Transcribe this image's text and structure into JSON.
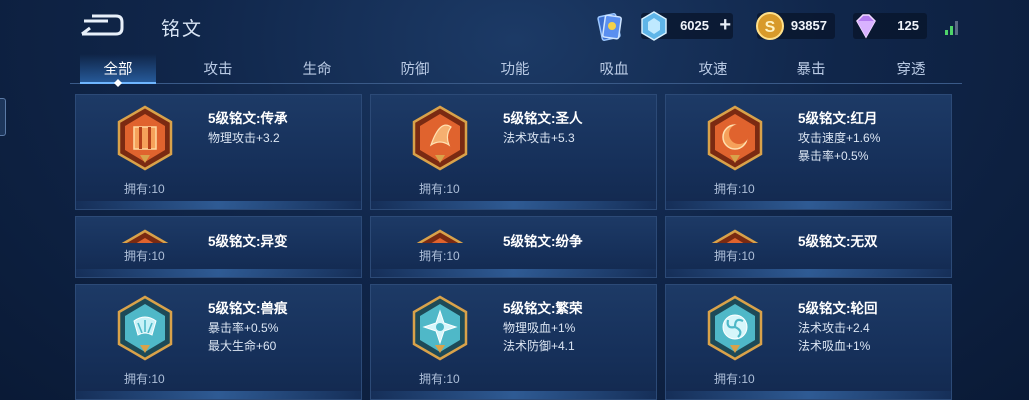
{
  "header": {
    "title": "铭文",
    "currencies": [
      {
        "name": "coupon",
        "value": "6025",
        "icon": "blue-crystal-icon"
      },
      {
        "name": "gold",
        "value": "93857",
        "icon": "gold-coin-icon"
      },
      {
        "name": "diamond",
        "value": "125",
        "icon": "purple-diamond-icon"
      }
    ]
  },
  "tabs": [
    {
      "label": "全部",
      "active": true
    },
    {
      "label": "攻击"
    },
    {
      "label": "生命"
    },
    {
      "label": "防御"
    },
    {
      "label": "功能"
    },
    {
      "label": "吸血"
    },
    {
      "label": "攻速"
    },
    {
      "label": "暴击"
    },
    {
      "label": "穿透"
    }
  ],
  "inscriptions": [
    {
      "name": "5级铭文:传承",
      "stats": [
        "物理攻击+3.2"
      ],
      "owned": "拥有:10",
      "color": "red"
    },
    {
      "name": "5级铭文:圣人",
      "stats": [
        "法术攻击+5.3"
      ],
      "owned": "拥有:10",
      "color": "red"
    },
    {
      "name": "5级铭文:红月",
      "stats": [
        "攻击速度+1.6%",
        "暴击率+0.5%"
      ],
      "owned": "拥有:10",
      "color": "red"
    },
    {
      "name": "5级铭文:异变",
      "stats": [],
      "owned": "拥有:10",
      "color": "red"
    },
    {
      "name": "5级铭文:纷争",
      "stats": [],
      "owned": "拥有:10",
      "color": "red"
    },
    {
      "name": "5级铭文:无双",
      "stats": [],
      "owned": "拥有:10",
      "color": "red"
    },
    {
      "name": "5级铭文:兽痕",
      "stats": [
        "暴击率+0.5%",
        "最大生命+60"
      ],
      "owned": "拥有:10",
      "color": "teal"
    },
    {
      "name": "5级铭文:繁荣",
      "stats": [
        "物理吸血+1%",
        "法术防御+4.1"
      ],
      "owned": "拥有:10",
      "color": "teal"
    },
    {
      "name": "5级铭文:轮回",
      "stats": [
        "法术攻击+2.4",
        "法术吸血+1%"
      ],
      "owned": "拥有:10",
      "color": "teal"
    }
  ],
  "colors": {
    "red": "#e0632e",
    "teal": "#4fb8c8",
    "gold": "#c9a04a",
    "accent": "#6fb6ff"
  }
}
